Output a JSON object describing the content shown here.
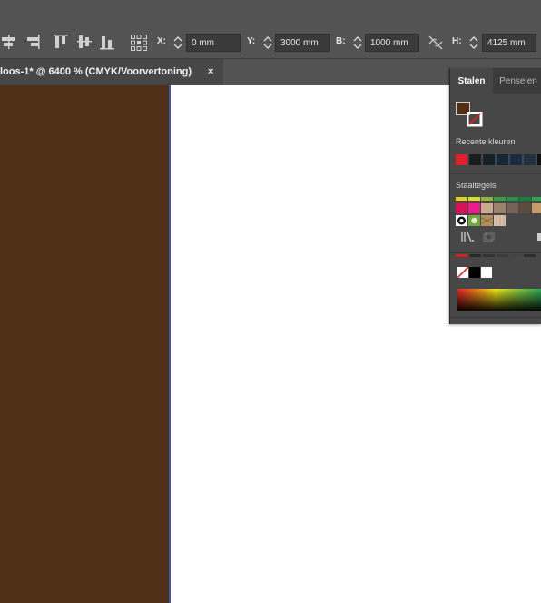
{
  "toolbar": {
    "x_label": "X:",
    "x_value": "0 mm",
    "y_label": "Y:",
    "y_value": "3000 mm",
    "w_label": "B:",
    "w_value": "1000 mm",
    "h_label": "H:",
    "h_value": "4125 mm"
  },
  "document_tab": {
    "title": "loos-1* @ 6400 % (CMYK/Voorvertoning)",
    "close": "×"
  },
  "canvas": {
    "frame_fill_color": "#4f3016",
    "page_color": "#ffffff"
  },
  "swatches_panel": {
    "tabs": [
      "Stalen",
      "Penselen"
    ],
    "fill_color": "#4f3016",
    "recent_label": "Recente kleuren",
    "recent_colors": [
      "#e01f26",
      "#1b1c1e",
      "#162029",
      "#18263a",
      "#1c2b40",
      "#22303f",
      "#111111"
    ],
    "tiles_label": "Staaltegels",
    "tile_row1": [
      "#e4d11e",
      "#d7df22",
      "#8db83b",
      "#3c9a3f",
      "#259447",
      "#1a7f3d",
      "#2aa654"
    ],
    "tile_row2": [
      "#d4145a",
      "#e91e8c",
      "#c8ab8e",
      "#9c826b",
      "#736357",
      "#5b4c40",
      "#c49b6a"
    ],
    "tile_row3": [
      "#ffffff",
      "#6ea843",
      "#b68d5f",
      "#d9c1ad"
    ],
    "lower_row": [
      "#cc2222",
      "#2a2a2a",
      "#333333",
      "#3b3b3b",
      "#444444",
      "#2d2d2d"
    ]
  }
}
